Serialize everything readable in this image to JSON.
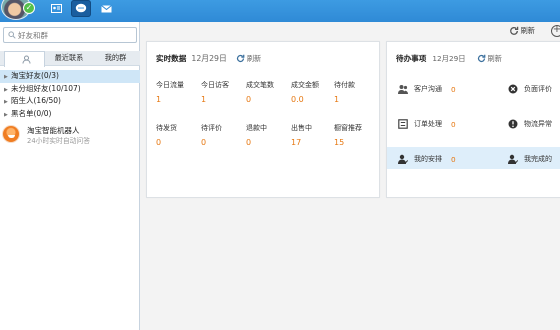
{
  "header": {
    "tabs": [
      {
        "icon": "contact-card-icon"
      },
      {
        "icon": "chat-bubble-icon",
        "active": true
      },
      {
        "icon": "envelope-icon"
      }
    ],
    "status": "online"
  },
  "sidebar": {
    "search_placeholder": "好友和群",
    "tabs": [
      {
        "label": "",
        "icon": "person-icon",
        "active": true
      },
      {
        "label": "最近联系"
      },
      {
        "label": "我的群"
      }
    ],
    "groups": [
      {
        "label": "淘宝好友(0/3)",
        "selected": true
      },
      {
        "label": "未分组好友(10/107)"
      },
      {
        "label": "陌生人(16/50)"
      },
      {
        "label": "黑名单(0/0)"
      }
    ],
    "robot": {
      "name": "淘宝智能机器人",
      "subtitle": "24小时实时自动问答"
    }
  },
  "toolbar": {
    "refresh_label": "刷新"
  },
  "realtime": {
    "title": "实时数据",
    "date": "12月29日",
    "refresh_label": "刷新",
    "row1": [
      {
        "label": "今日流量",
        "value": "1"
      },
      {
        "label": "今日访客",
        "value": "1"
      },
      {
        "label": "成交笔数",
        "value": "0"
      },
      {
        "label": "成交金额",
        "value": "0.0"
      },
      {
        "label": "待付款",
        "value": "1"
      }
    ],
    "row2": [
      {
        "label": "待发货",
        "value": "0"
      },
      {
        "label": "待评价",
        "value": "0"
      },
      {
        "label": "退款中",
        "value": "0"
      },
      {
        "label": "出售中",
        "value": "17"
      },
      {
        "label": "橱窗推荐",
        "value": "15"
      }
    ]
  },
  "todo": {
    "title": "待办事项",
    "date": "12月29日",
    "refresh_label": "刷新",
    "items": [
      {
        "label": "客户沟通",
        "count": "0",
        "icon": "customer-icon"
      },
      {
        "label": "负面评价",
        "count": "",
        "icon": "negative-review-icon"
      },
      {
        "label": "订单处理",
        "count": "0",
        "icon": "order-icon"
      },
      {
        "label": "物流异常",
        "count": "",
        "icon": "logistics-icon"
      },
      {
        "label": "我的安排",
        "count": "0",
        "icon": "my-schedule-icon"
      },
      {
        "label": "我完成的",
        "count": "",
        "icon": "my-done-icon"
      }
    ]
  },
  "colors": {
    "accent": "#3d9be2",
    "value": "#e67812",
    "highlight": "#deeefa"
  }
}
